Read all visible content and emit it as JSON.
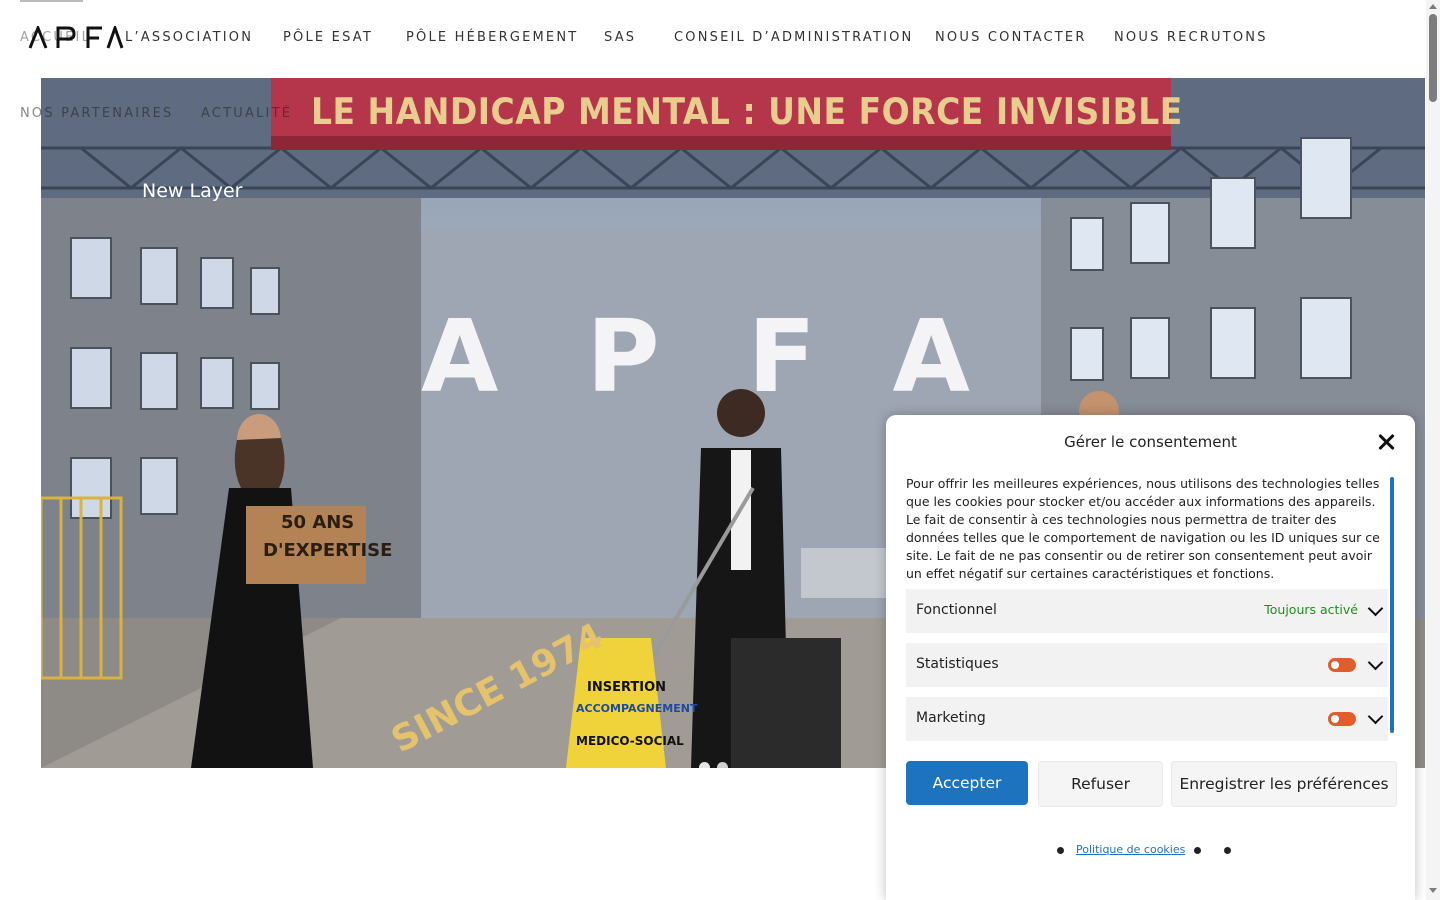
{
  "brand": {
    "logo_text": "APFA"
  },
  "nav": {
    "items": [
      {
        "label": "Accueil"
      },
      {
        "label": "L’association"
      },
      {
        "label": "Pôle ESAT"
      },
      {
        "label": "Pôle hébergement"
      },
      {
        "label": "SAS"
      },
      {
        "label": "Conseil d’administration"
      },
      {
        "label": "Nous contacter"
      },
      {
        "label": "Nous recrutons"
      },
      {
        "label": "Nos partenaires"
      },
      {
        "label": "Actualité"
      }
    ]
  },
  "hero": {
    "banner": "LE HANDICAP MENTAL : UNE FORCE INVISIBLE",
    "layer_label": "New Layer",
    "wall_letters": "APFA",
    "box_text": [
      "50 ANS",
      "D'EXPERTISE"
    ],
    "floor_text": "SINCE 1974",
    "sign_text": [
      "INSERTION",
      "ACCOMPAGNEMENT",
      "MEDICO-SOCIAL"
    ]
  },
  "consent": {
    "title": "Gérer le consentement",
    "description": "Pour offrir les meilleures expériences, nous utilisons des technologies telles que les cookies pour stocker et/ou accéder aux informations des appareils. Le fait de consentir à ces technologies nous permettra de traiter des données telles que le comportement de navigation ou les ID uniques sur ce site. Le fait de ne pas consentir ou de retirer son consentement peut avoir un effet négatif sur certaines caractéristiques et fonctions.",
    "categories": [
      {
        "label": "Fonctionnel",
        "status": "Toujours activé"
      },
      {
        "label": "Statistiques"
      },
      {
        "label": "Marketing"
      }
    ],
    "buttons": {
      "accept": "Accepter",
      "refuse": "Refuser",
      "save": "Enregistrer les préférences"
    },
    "policy_link": "Politique de cookies",
    "colors": {
      "accent": "#1e73be",
      "toggle": "#e25d2c",
      "always_on": "#1e8e1e"
    }
  }
}
